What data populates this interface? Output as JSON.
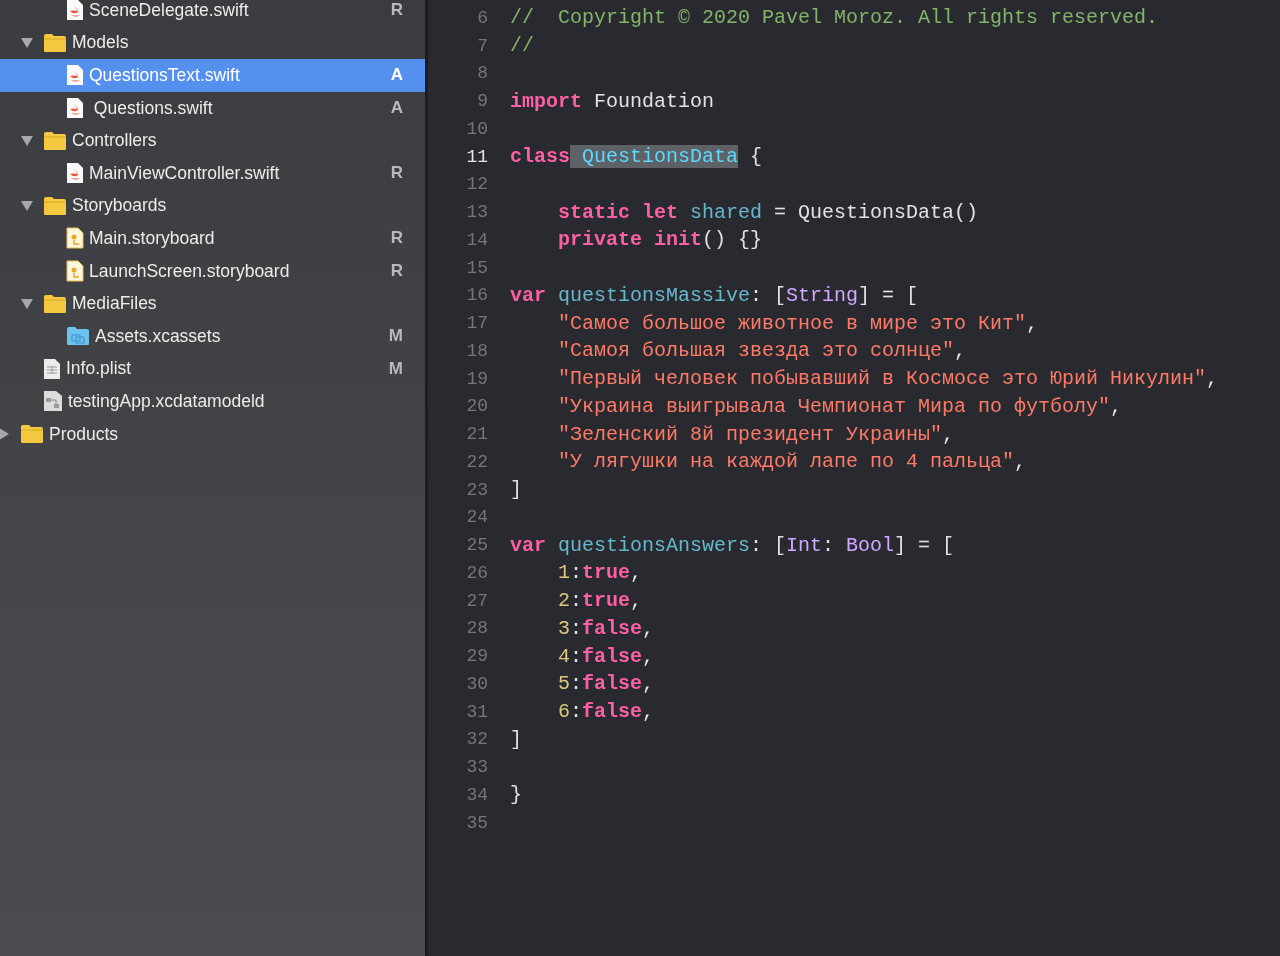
{
  "sidebar": {
    "tree": [
      {
        "children": [
          {
            "children": [
              {
                "name": "SceneDelegate.swift",
                "kind": "swift",
                "status": "R",
                "selected": false
              }
            ]
          },
          {
            "name": "Models",
            "kind": "folder",
            "expanded": true,
            "selected": false,
            "children": [
              {
                "name": "QuestionsText.swift",
                "kind": "swift",
                "status": "A",
                "selected": true
              },
              {
                "name": " Questions.swift",
                "kind": "swift",
                "status": "A",
                "selected": false
              }
            ]
          },
          {
            "name": "Controllers",
            "kind": "folder",
            "expanded": true,
            "selected": false,
            "children": [
              {
                "name": "MainViewController.swift",
                "kind": "swift",
                "status": "R",
                "selected": false
              }
            ]
          },
          {
            "name": "Storyboards",
            "kind": "folder",
            "expanded": true,
            "selected": false,
            "children": [
              {
                "name": "Main.storyboard",
                "kind": "storyboard",
                "status": "R",
                "selected": false
              },
              {
                "name": "LaunchScreen.storyboard",
                "kind": "storyboard",
                "status": "R",
                "selected": false
              }
            ]
          },
          {
            "name": "MediaFiles",
            "kind": "folder",
            "expanded": true,
            "selected": false,
            "children": [
              {
                "name": "Assets.xcassets",
                "kind": "assets",
                "status": "M",
                "selected": false
              }
            ]
          },
          {
            "name": "Info.plist",
            "kind": "plist",
            "status": "M",
            "selected": false
          },
          {
            "name": "testingApp.xcdatamodeld",
            "kind": "datamodel",
            "selected": false
          }
        ]
      },
      {
        "name": "Products",
        "kind": "folder",
        "expanded": false,
        "selected": false
      }
    ]
  },
  "editor": {
    "lines": [
      {
        "number": "6",
        "current": false,
        "indented": false,
        "tokens": [
          {
            "t": "//  Copyright © 2020 Pavel Moroz. All rights reserved.",
            "kind": "comment"
          }
        ]
      },
      {
        "number": "7",
        "current": false,
        "indented": false,
        "tokens": [
          {
            "t": "//",
            "kind": "comment"
          }
        ]
      },
      {
        "number": "8",
        "current": false
      },
      {
        "number": "9",
        "current": false,
        "indented": false,
        "tokens": [
          {
            "t": "import",
            "kind": "keyword"
          },
          {
            "t": "Foundation",
            "kind": "plain",
            "space": true
          }
        ]
      },
      {
        "number": "10",
        "current": false
      },
      {
        "number": "11",
        "current": true,
        "indented": false,
        "tokens": [
          {
            "t": "class",
            "kind": "keyword"
          },
          {
            "t": "QuestionsData",
            "kind": "decl",
            "space": true,
            "highlighted": true
          },
          {
            "t": "{",
            "kind": "plain",
            "space": true
          }
        ]
      },
      {
        "number": "12",
        "current": false
      },
      {
        "number": "13",
        "current": false,
        "indented": true,
        "tokens": [
          {
            "t": "static",
            "kind": "keyword"
          },
          {
            "t": "let",
            "kind": "keyword",
            "space": true
          },
          {
            "t": "shared",
            "kind": "ident",
            "space": true
          },
          {
            "t": "= QuestionsData()",
            "kind": "plain",
            "space": true
          }
        ]
      },
      {
        "number": "14",
        "current": false,
        "indented": true,
        "tokens": [
          {
            "t": "private",
            "kind": "keyword"
          },
          {
            "t": "init",
            "kind": "keyword",
            "space": true
          },
          {
            "t": "() {}",
            "kind": "plain"
          }
        ]
      },
      {
        "number": "15",
        "current": false
      },
      {
        "number": "16",
        "current": false,
        "indented": false,
        "tokens": [
          {
            "t": "var",
            "kind": "keyword"
          },
          {
            "t": "questionsMassive",
            "kind": "ident",
            "space": true
          },
          {
            "t": ": [",
            "kind": "plain"
          },
          {
            "t": "String",
            "kind": "type"
          },
          {
            "t": "] = [",
            "kind": "plain"
          }
        ]
      },
      {
        "number": "17",
        "current": false,
        "indented": true,
        "tokens": [
          {
            "t": "\"Самое большое животное в мире это Кит\"",
            "kind": "string"
          },
          {
            "t": ",",
            "kind": "plain"
          }
        ]
      },
      {
        "number": "18",
        "current": false,
        "indented": true,
        "tokens": [
          {
            "t": "\"Самоя большая звезда это солнце\"",
            "kind": "string"
          },
          {
            "t": ",",
            "kind": "plain"
          }
        ]
      },
      {
        "number": "19",
        "current": false,
        "indented": true,
        "tokens": [
          {
            "t": "\"Первый человек побывавший в Космосе это Юрий Никулин\"",
            "kind": "string"
          },
          {
            "t": ",",
            "kind": "plain"
          }
        ]
      },
      {
        "number": "20",
        "current": false,
        "indented": true,
        "tokens": [
          {
            "t": "\"Украина выигрывала Чемпионат Мира по футболу\"",
            "kind": "string"
          },
          {
            "t": ",",
            "kind": "plain"
          }
        ]
      },
      {
        "number": "21",
        "current": false,
        "indented": true,
        "tokens": [
          {
            "t": "\"Зеленский 8й президент Украины\"",
            "kind": "string"
          },
          {
            "t": ",",
            "kind": "plain"
          }
        ]
      },
      {
        "number": "22",
        "current": false,
        "indented": true,
        "tokens": [
          {
            "t": "\"У лягушки на каждой лапе по 4 пальца\"",
            "kind": "string"
          },
          {
            "t": ",",
            "kind": "plain"
          }
        ]
      },
      {
        "number": "23",
        "current": false,
        "indented": false,
        "tokens": [
          {
            "t": "]",
            "kind": "plain"
          }
        ]
      },
      {
        "number": "24",
        "current": false
      },
      {
        "number": "25",
        "current": false,
        "indented": false,
        "tokens": [
          {
            "t": "var",
            "kind": "keyword"
          },
          {
            "t": "questionsAnswers",
            "kind": "ident",
            "space": true
          },
          {
            "t": ": [",
            "kind": "plain"
          },
          {
            "t": "Int",
            "kind": "type"
          },
          {
            "t": ":",
            "kind": "plain"
          },
          {
            "t": "Bool",
            "kind": "type",
            "space": true
          },
          {
            "t": "] = [",
            "kind": "plain"
          }
        ]
      },
      {
        "number": "26",
        "current": false,
        "indented": true,
        "tokens": [
          {
            "t": "1",
            "kind": "number"
          },
          {
            "t": ":",
            "kind": "plain"
          },
          {
            "t": "true",
            "kind": "keyword"
          },
          {
            "t": ",",
            "kind": "plain"
          }
        ]
      },
      {
        "number": "27",
        "current": false,
        "indented": true,
        "tokens": [
          {
            "t": "2",
            "kind": "number"
          },
          {
            "t": ":",
            "kind": "plain"
          },
          {
            "t": "true",
            "kind": "keyword"
          },
          {
            "t": ",",
            "kind": "plain"
          }
        ]
      },
      {
        "number": "28",
        "current": false,
        "indented": true,
        "tokens": [
          {
            "t": "3",
            "kind": "number"
          },
          {
            "t": ":",
            "kind": "plain"
          },
          {
            "t": "false",
            "kind": "keyword"
          },
          {
            "t": ",",
            "kind": "plain"
          }
        ]
      },
      {
        "number": "29",
        "current": false,
        "indented": true,
        "tokens": [
          {
            "t": "4",
            "kind": "number"
          },
          {
            "t": ":",
            "kind": "plain"
          },
          {
            "t": "false",
            "kind": "keyword"
          },
          {
            "t": ",",
            "kind": "plain"
          }
        ]
      },
      {
        "number": "30",
        "current": false,
        "indented": true,
        "tokens": [
          {
            "t": "5",
            "kind": "number"
          },
          {
            "t": ":",
            "kind": "plain"
          },
          {
            "t": "false",
            "kind": "keyword"
          },
          {
            "t": ",",
            "kind": "plain"
          }
        ]
      },
      {
        "number": "31",
        "current": false,
        "indented": true,
        "tokens": [
          {
            "t": "6",
            "kind": "number"
          },
          {
            "t": ":",
            "kind": "plain"
          },
          {
            "t": "false",
            "kind": "keyword"
          },
          {
            "t": ",",
            "kind": "plain"
          }
        ]
      },
      {
        "number": "32",
        "current": false,
        "indented": false,
        "tokens": [
          {
            "t": "]",
            "kind": "plain"
          }
        ]
      },
      {
        "number": "33",
        "current": false
      },
      {
        "number": "34",
        "current": false,
        "indented": false,
        "tokens": [
          {
            "t": "}",
            "kind": "plain"
          }
        ]
      },
      {
        "number": "35",
        "current": false
      }
    ]
  }
}
